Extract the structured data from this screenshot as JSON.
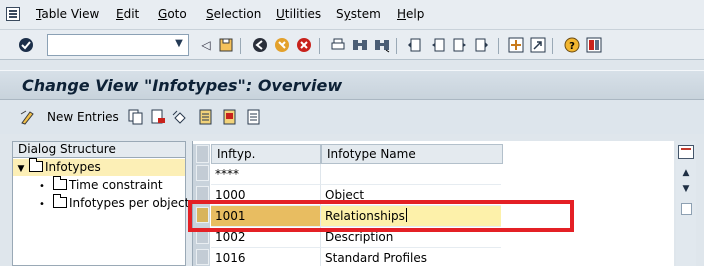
{
  "menu": {
    "items": [
      {
        "label": "Table View",
        "underline": "T"
      },
      {
        "label": "Edit",
        "underline": "E"
      },
      {
        "label": "Goto",
        "underline": "G"
      },
      {
        "label": "Selection",
        "underline": "S"
      },
      {
        "label": "Utilities",
        "underline": "U"
      },
      {
        "label": "System",
        "underline": "y"
      },
      {
        "label": "Help",
        "underline": "H"
      }
    ]
  },
  "toolbar": {
    "command_field_value": "",
    "icons": [
      "enter-icon",
      "back-icon",
      "save-icon",
      "back-green-icon",
      "exit-icon",
      "cancel-icon",
      "print-icon",
      "find-icon",
      "find-next-icon",
      "first-page-icon",
      "prev-page-icon",
      "next-page-icon",
      "last-page-icon",
      "create-session-icon",
      "shortcut-icon",
      "help-icon",
      "customize-layout-icon"
    ]
  },
  "title": "Change View \"Infotypes\": Overview",
  "app_toolbar": {
    "new_entries_label": "New Entries"
  },
  "dialog_structure": {
    "header": "Dialog Structure",
    "items": [
      {
        "label": "Infotypes",
        "level": 0,
        "selected": true
      },
      {
        "label": "Time constraint",
        "level": 1,
        "selected": false
      },
      {
        "label": "Infotypes per object",
        "level": 1,
        "selected": false
      }
    ]
  },
  "table": {
    "columns": [
      "Inftyp.",
      "Infotype Name"
    ],
    "rows": [
      {
        "infotype": "****",
        "name": "",
        "highlighted": false
      },
      {
        "infotype": "1000",
        "name": "Object",
        "highlighted": false
      },
      {
        "infotype": "1001",
        "name": "Relationships",
        "highlighted": true
      },
      {
        "infotype": "1002",
        "name": "Description",
        "highlighted": false
      },
      {
        "infotype": "1016",
        "name": "Standard Profiles",
        "highlighted": false
      }
    ]
  },
  "colors": {
    "highlight_border": "#e42025",
    "selected_row_key": "#e8bd61",
    "selected_row_name": "#fdf1aa"
  }
}
